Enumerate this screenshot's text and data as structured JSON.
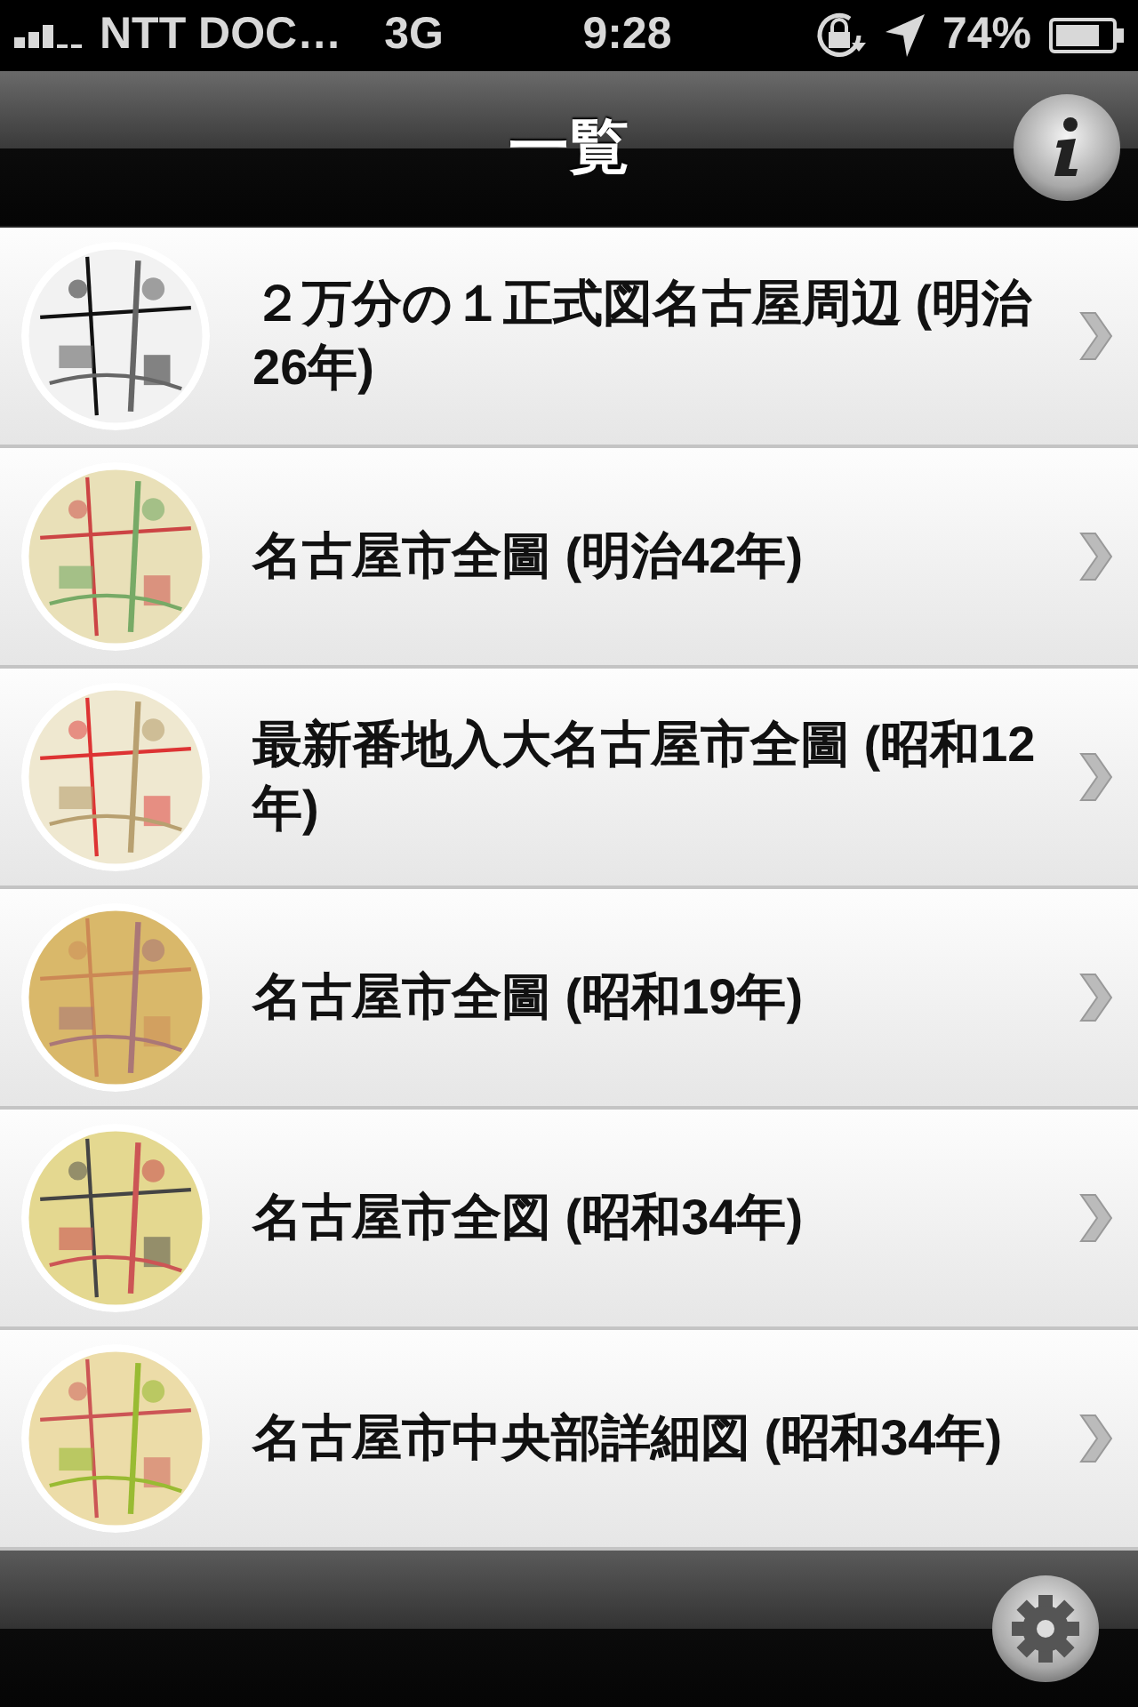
{
  "status_bar": {
    "carrier": "NTT DOC…",
    "network": "3G",
    "time": "9:28",
    "battery": "74%"
  },
  "nav_bar": {
    "title": "一覧"
  },
  "items": [
    {
      "title": "２万分の１正式図名古屋周辺 (明治26年)"
    },
    {
      "title": "名古屋市全圖 (明治42年)"
    },
    {
      "title": "最新番地入大名古屋市全圖 (昭和12年)"
    },
    {
      "title": "名古屋市全圖 (昭和19年)"
    },
    {
      "title": "名古屋市全図 (昭和34年)"
    },
    {
      "title": "名古屋市中央部詳細図 (昭和34年)"
    }
  ]
}
